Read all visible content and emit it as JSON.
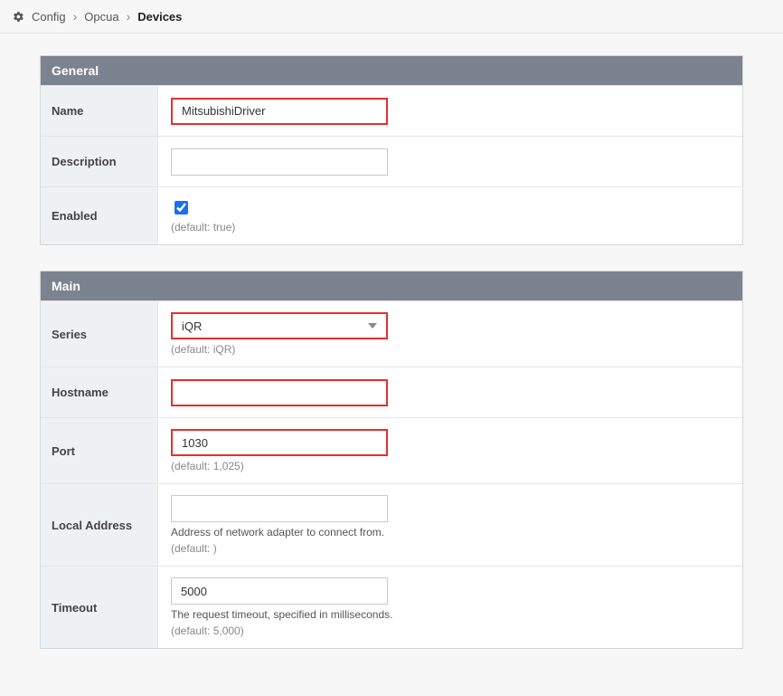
{
  "breadcrumb": {
    "config": "Config",
    "opcua": "Opcua",
    "devices": "Devices"
  },
  "panels": {
    "general": {
      "title": "General",
      "name": {
        "label": "Name",
        "value": "MitsubishiDriver"
      },
      "description": {
        "label": "Description",
        "value": ""
      },
      "enabled": {
        "label": "Enabled",
        "hint": "(default: true)"
      }
    },
    "main": {
      "title": "Main",
      "series": {
        "label": "Series",
        "value": "iQR",
        "hint": "(default: iQR)"
      },
      "hostname": {
        "label": "Hostname",
        "value": ""
      },
      "port": {
        "label": "Port",
        "value": "1030",
        "hint": "(default: 1,025)"
      },
      "localAddress": {
        "label": "Local Address",
        "value": "",
        "desc": "Address of network adapter to connect from.",
        "hint": "(default: )"
      },
      "timeout": {
        "label": "Timeout",
        "value": "5000",
        "desc": "The request timeout, specified in milliseconds.",
        "hint": "(default: 5,000)"
      }
    }
  }
}
